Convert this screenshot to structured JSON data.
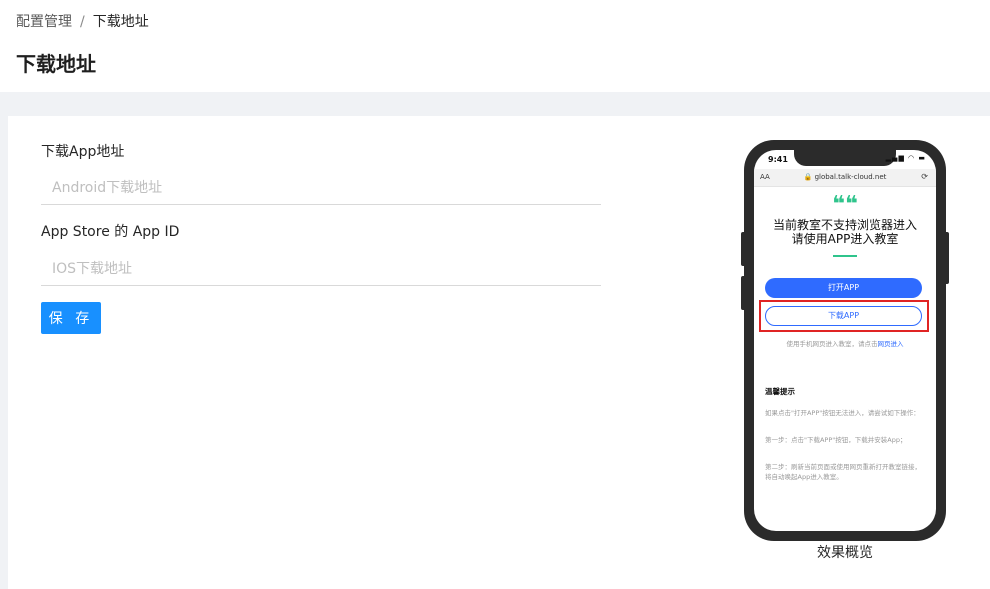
{
  "breadcrumb": {
    "parent": "配置管理",
    "separator": "/",
    "current": "下载地址"
  },
  "page": {
    "title": "下载地址"
  },
  "form": {
    "android_label": "下载App地址",
    "android_placeholder": "Android下载地址",
    "android_value": "",
    "ios_label": "App Store 的 App ID",
    "ios_placeholder": "IOS下载地址",
    "ios_value": "",
    "save_label": "保 存"
  },
  "preview": {
    "caption": "效果概览",
    "status_time": "9:41",
    "status_icons": "▂▄▆ ◠ ▬",
    "url_aa": "AA",
    "url": "🔒 global.talk-cloud.net",
    "reload_icon": "⟳",
    "quote_mark": "❝❝",
    "headline_line1": "当前教室不支持浏览器进入",
    "headline_line2": "请使用APP进入教室",
    "open_app": "打开APP",
    "download_app": "下载APP",
    "web_hint_prefix": "使用手机网页进入教室，请点击",
    "web_hint_link": "网页进入",
    "tips_title": "温馨提示",
    "tip1": "如果点击\"打开APP\"按钮无法进入，请尝试如下操作：",
    "tip2": "第一步：点击\"下载APP\"按钮，下载并安装App；",
    "tip3": "第二步：刷新当前页面或使用网页重新打开教室链接，将自动唤起App进入教室。"
  },
  "colors": {
    "primary": "#1890ff",
    "accent_green": "#2fc48c",
    "app_blue": "#2f6bff",
    "highlight_red": "#e02424"
  }
}
